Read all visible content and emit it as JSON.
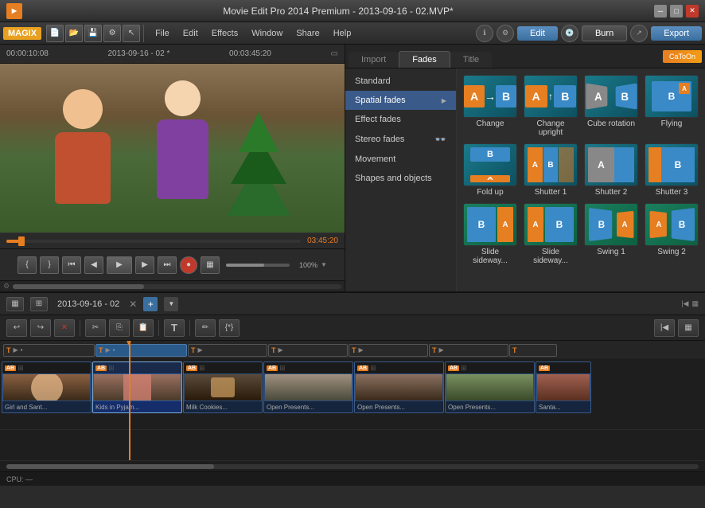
{
  "titlebar": {
    "title": "Movie Edit Pro 2014 Premium - 2013-09-16 - 02.MVP*",
    "min_btn": "─",
    "max_btn": "□",
    "close_btn": "✕"
  },
  "menubar": {
    "logo": "MAGIX",
    "file": "File",
    "edit": "Edit",
    "effects": "Effects",
    "window": "Window",
    "share": "Share",
    "help": "Help",
    "edit_btn": "Edit",
    "burn_btn": "Burn",
    "export_btn": "Export"
  },
  "preview": {
    "time_start": "00:00:10:08",
    "clip_name": "2013-09-16 - 02 *",
    "time_end": "00:03:45:20",
    "timeline_time": "03:45:20",
    "zoom": "100%"
  },
  "effects_panel": {
    "tab_import": "Import",
    "tab_fades": "Fades",
    "tab_title": "Title",
    "tab_cartoon": "CaToOn",
    "menu_items": [
      {
        "label": "Standard",
        "has_arrow": false
      },
      {
        "label": "Spatial fades",
        "has_arrow": true
      },
      {
        "label": "Effect fades",
        "has_arrow": false
      },
      {
        "label": "Stereo fades",
        "has_arrow": false
      },
      {
        "label": "Movement",
        "has_arrow": false
      },
      {
        "label": "Shapes and objects",
        "has_arrow": false
      }
    ],
    "effects": [
      {
        "id": "change",
        "label": "Change",
        "type": "change"
      },
      {
        "id": "change-upright",
        "label": "Change upright",
        "type": "upright"
      },
      {
        "id": "cube-rotation",
        "label": "Cube rotation",
        "type": "cube"
      },
      {
        "id": "flying",
        "label": "Flying",
        "type": "flying"
      },
      {
        "id": "fold-up",
        "label": "Fold up",
        "type": "fold"
      },
      {
        "id": "shutter1",
        "label": "Shutter 1",
        "type": "shutter1"
      },
      {
        "id": "shutter2",
        "label": "Shutter 2",
        "type": "shutter2"
      },
      {
        "id": "shutter3",
        "label": "Shutter 3",
        "type": "shutter3"
      },
      {
        "id": "slide-sideway1",
        "label": "Slide sideway...",
        "type": "slide1"
      },
      {
        "id": "slide-sideway2",
        "label": "Slide sideway...",
        "type": "slide2"
      },
      {
        "id": "swing1",
        "label": "Swing 1",
        "type": "swing1"
      },
      {
        "id": "swing2",
        "label": "Swing 2",
        "type": "swing2"
      }
    ]
  },
  "timeline": {
    "title": "2013-09-16 - 02",
    "clips": [
      {
        "id": 1,
        "name": "Girl and Sant...",
        "selected": false
      },
      {
        "id": 2,
        "name": "Kids in Pyjam...",
        "selected": true
      },
      {
        "id": 3,
        "name": "Milk Cookies...",
        "selected": false
      },
      {
        "id": 4,
        "name": "Open Presents...",
        "selected": false
      },
      {
        "id": 5,
        "name": "Open Presents...",
        "selected": false
      },
      {
        "id": 6,
        "name": "Open Presents...",
        "selected": false
      },
      {
        "id": 7,
        "name": "Santa...",
        "selected": false
      }
    ]
  },
  "status": {
    "cpu_label": "CPU: —"
  }
}
